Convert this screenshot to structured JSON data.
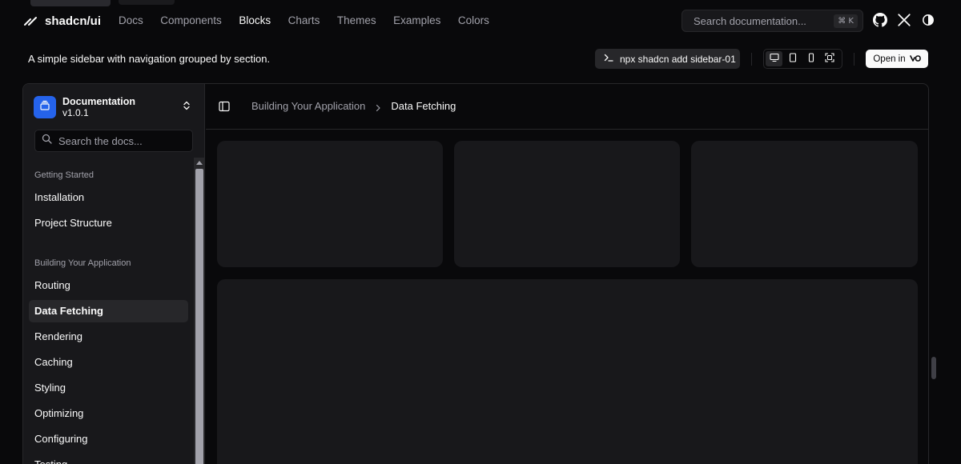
{
  "app": {
    "logo_text": "shadcn/ui"
  },
  "nav": {
    "links": [
      "Docs",
      "Components",
      "Blocks",
      "Charts",
      "Themes",
      "Examples",
      "Colors"
    ],
    "active": "Blocks"
  },
  "search": {
    "placeholder": "Search documentation...",
    "shortcut": "⌘ K"
  },
  "header_icons": [
    "github-icon",
    "x-icon",
    "theme-toggle-icon"
  ],
  "block": {
    "description": "A simple sidebar with navigation grouped by section.",
    "command": "npx shadcn add sidebar-01",
    "view_modes": [
      "desktop-icon",
      "tablet-icon",
      "mobile-icon",
      "fullscreen-icon"
    ],
    "active_view": "desktop-icon",
    "open_label": "Open in"
  },
  "sidebar": {
    "team_title": "Documentation",
    "team_version": "v1.0.1",
    "search_placeholder": "Search the docs...",
    "groups": [
      {
        "label": "Getting Started",
        "items": [
          "Installation",
          "Project Structure"
        ]
      },
      {
        "label": "Building Your Application",
        "items": [
          "Routing",
          "Data Fetching",
          "Rendering",
          "Caching",
          "Styling",
          "Optimizing",
          "Configuring",
          "Testing"
        ]
      }
    ],
    "active_item": "Data Fetching"
  },
  "breadcrumb": {
    "parent": "Building Your Application",
    "current": "Data Fetching"
  },
  "colors": {
    "background": "#09090b",
    "card": "#18181b",
    "accent": "#2563eb",
    "border": "#27272a",
    "muted_text": "#a1a1aa"
  }
}
